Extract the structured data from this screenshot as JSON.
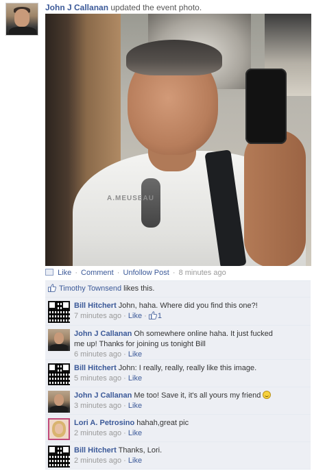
{
  "story": {
    "actor": "John J Callanan",
    "action": "updated the event photo."
  },
  "photo": {
    "shirt_text": "A.MEUSEAU"
  },
  "actions": {
    "like": "Like",
    "comment": "Comment",
    "unfollow": "Unfollow Post",
    "time": "8 minutes ago",
    "sep": "·"
  },
  "likes": {
    "name": "Timothy Townsend",
    "suffix": "likes this."
  },
  "comments": [
    {
      "author": "Bill Hitchert",
      "line1": "John, haha. Where did you find this one?!",
      "line2": "",
      "time": "7 minutes ago",
      "like": "Like",
      "like_count": "1"
    },
    {
      "author": "John J Callanan",
      "line1": "Oh somewhere online haha. It just fucked",
      "line2": "me up! Thanks for joining us tonight Bill",
      "time": "6 minutes ago",
      "like": "Like"
    },
    {
      "author": "Bill Hitchert",
      "line1": "John: I really, really, really like this image.",
      "line2": "",
      "time": "5 minutes ago",
      "like": "Like"
    },
    {
      "author": "John J Callanan",
      "line1": "Me too! Save it, it's all yours my friend",
      "line2": "",
      "time": "3 minutes ago",
      "like": "Like"
    },
    {
      "author": "Lori A. Petrosino",
      "line1": "hahah,great pic",
      "line2": "",
      "time": "2 minutes ago",
      "like": "Like"
    },
    {
      "author": "Bill Hitchert",
      "line1": "Thanks, Lori.",
      "line2": "",
      "time": "2 minutes ago",
      "like": "Like"
    }
  ],
  "colors": {
    "link": "#3b5998",
    "muted": "#999999",
    "ufi_bg": "#edeff4"
  }
}
